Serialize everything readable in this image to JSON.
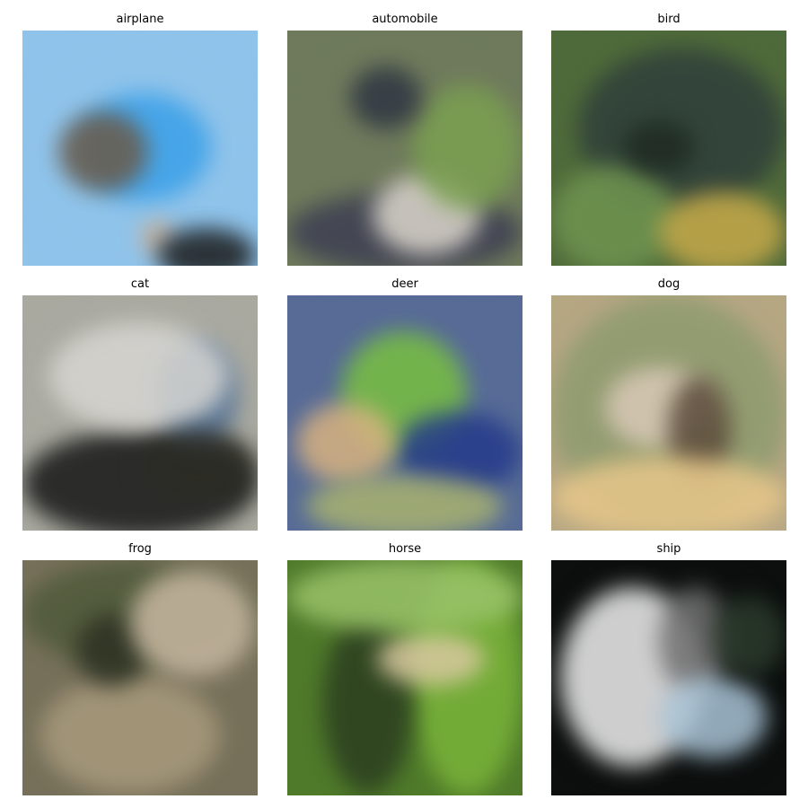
{
  "figure": {
    "panels": [
      {
        "title": "airplane",
        "base": "#8fc3ea",
        "blobs": [
          "#3aa0e8",
          "#6b5a48",
          "#c8b098",
          "#1b1b1b",
          "#e8eef6"
        ]
      },
      {
        "title": "automobile",
        "base": "#6f7a5c",
        "blobs": [
          "#3d3f52",
          "#dcd6cc",
          "#7aa050",
          "#2f3542",
          "#b9c3a8"
        ]
      },
      {
        "title": "bird",
        "base": "#4f6a3a",
        "blobs": [
          "#2f3f3a",
          "#6f9450",
          "#c6a94a",
          "#1f2a22",
          "#8aa16a"
        ]
      },
      {
        "title": "cat",
        "base": "#a9a9a0",
        "blobs": [
          "#161616",
          "#4f6f94",
          "#d7d6d2",
          "#2c2c25",
          "#7f8c7f"
        ]
      },
      {
        "title": "deer",
        "base": "#576b96",
        "blobs": [
          "#78c040",
          "#243a8a",
          "#d8b280",
          "#a9b36f",
          "#2b2f40"
        ]
      },
      {
        "title": "dog",
        "base": "#b6a783",
        "blobs": [
          "#8e9b6f",
          "#d9c9b7",
          "#5a4a3a",
          "#e8c78a",
          "#a2a38a"
        ]
      },
      {
        "title": "frog",
        "base": "#76705a",
        "blobs": [
          "#4f5a3a",
          "#a89a7c",
          "#2c3122",
          "#c9b8a2",
          "#6f7a4f"
        ]
      },
      {
        "title": "horse",
        "base": "#4f7a2a",
        "blobs": [
          "#7ab43a",
          "#2b3d20",
          "#d9c9a0",
          "#9ac36a",
          "#1f2a1a"
        ]
      },
      {
        "title": "ship",
        "base": "#0c0f0e",
        "blobs": [
          "#f0f0f0",
          "#6f6f6f",
          "#a9c3d6",
          "#2b3a2c",
          "#d9d9d9"
        ]
      }
    ]
  }
}
